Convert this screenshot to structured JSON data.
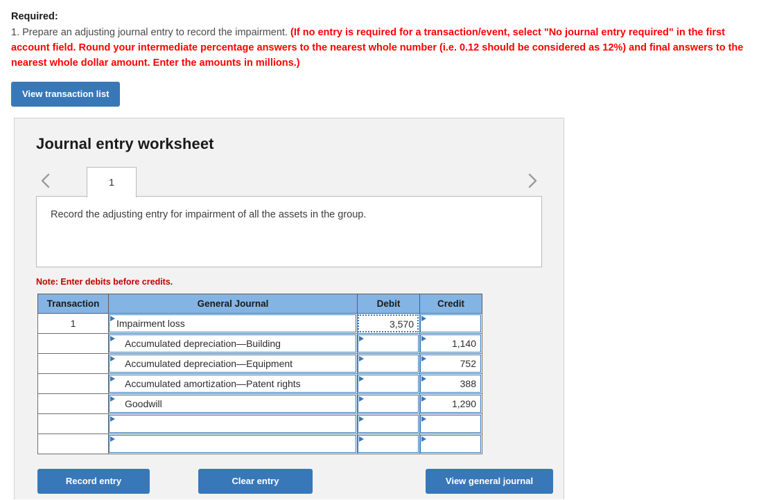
{
  "required": {
    "heading": "Required:",
    "line_plain": "1. Prepare an adjusting journal entry to record the impairment. ",
    "line_emphasis": "(If no entry is required for a transaction/event, select \"No journal entry required\" in the first account field. Round your intermediate percentage answers to the nearest whole number (i.e. 0.12 should be considered as 12%) and final answers to the nearest whole dollar amount. Enter the amounts in millions.)"
  },
  "buttons": {
    "view_transaction_list": "View transaction list",
    "record_entry": "Record entry",
    "clear_entry": "Clear entry",
    "view_general_journal": "View general journal"
  },
  "worksheet": {
    "title": "Journal entry worksheet",
    "tabs": [
      {
        "label": "1",
        "active": true
      }
    ],
    "nav": {
      "prev_icon": "chevron-left-icon",
      "next_icon": "chevron-right-icon"
    },
    "description": "Record the adjusting entry for impairment of all the assets in the group.",
    "note": "Note: Enter debits before credits."
  },
  "table": {
    "headers": [
      "Transaction",
      "General Journal",
      "Debit",
      "Credit"
    ],
    "rows": [
      {
        "transaction": "1",
        "account": "Impairment loss",
        "indent": false,
        "debit": "3,570",
        "credit": "",
        "debit_focused": true
      },
      {
        "transaction": "",
        "account": "Accumulated depreciation—Building",
        "indent": true,
        "debit": "",
        "credit": "1,140",
        "debit_focused": false
      },
      {
        "transaction": "",
        "account": "Accumulated depreciation—Equipment",
        "indent": true,
        "debit": "",
        "credit": "752",
        "debit_focused": false
      },
      {
        "transaction": "",
        "account": "Accumulated amortization—Patent rights",
        "indent": true,
        "debit": "",
        "credit": "388",
        "debit_focused": false
      },
      {
        "transaction": "",
        "account": "Goodwill",
        "indent": true,
        "debit": "",
        "credit": "1,290",
        "debit_focused": false
      },
      {
        "transaction": "",
        "account": "",
        "indent": true,
        "debit": "",
        "credit": "",
        "debit_focused": false
      },
      {
        "transaction": "",
        "account": "",
        "indent": true,
        "debit": "",
        "credit": "",
        "debit_focused": false
      }
    ]
  },
  "colors": {
    "accent_blue": "#3878b9",
    "header_blue": "#83b4e3",
    "alert_red": "#ff0000",
    "note_red": "#c00000",
    "panel_gray": "#f2f2f2"
  }
}
